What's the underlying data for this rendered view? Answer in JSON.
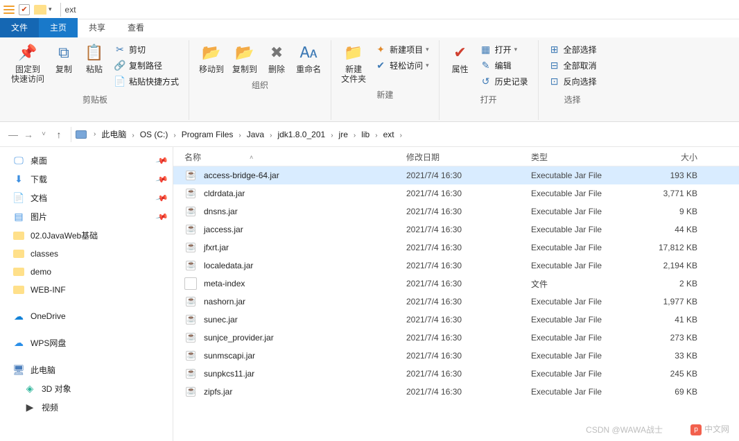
{
  "title": "ext",
  "tabs": {
    "file": "文件",
    "home": "主页",
    "share": "共享",
    "view": "查看"
  },
  "ribbon": {
    "clipboard": {
      "label": "剪贴板",
      "pin": "固定到\n快速访问",
      "copy": "复制",
      "paste": "粘贴",
      "cut": "剪切",
      "copy_path": "复制路径",
      "paste_shortcut": "粘贴快捷方式"
    },
    "organize": {
      "label": "组织",
      "move_to": "移动到",
      "copy_to": "复制到",
      "delete": "删除",
      "rename": "重命名"
    },
    "new": {
      "label": "新建",
      "new_folder": "新建\n文件夹",
      "new_item": "新建项目",
      "easy_access": "轻松访问"
    },
    "open": {
      "label": "打开",
      "properties": "属性",
      "open": "打开",
      "edit": "编辑",
      "history": "历史记录"
    },
    "select": {
      "label": "选择",
      "select_all": "全部选择",
      "select_none": "全部取消",
      "invert": "反向选择"
    }
  },
  "breadcrumb": [
    "此电脑",
    "OS (C:)",
    "Program Files",
    "Java",
    "jdk1.8.0_201",
    "jre",
    "lib",
    "ext"
  ],
  "sidebar": {
    "quick": [
      {
        "label": "桌面",
        "icon": "desktop",
        "pinned": true
      },
      {
        "label": "下载",
        "icon": "download",
        "pinned": true
      },
      {
        "label": "文档",
        "icon": "document",
        "pinned": true
      },
      {
        "label": "图片",
        "icon": "picture",
        "pinned": true
      },
      {
        "label": "02.0JavaWeb基础",
        "icon": "folder"
      },
      {
        "label": "classes",
        "icon": "folder"
      },
      {
        "label": "demo",
        "icon": "folder"
      },
      {
        "label": "WEB-INF",
        "icon": "folder"
      }
    ],
    "onedrive": "OneDrive",
    "wps": "WPS网盘",
    "thispc": "此电脑",
    "pc_items": [
      {
        "label": "3D 对象",
        "icon": "3d"
      },
      {
        "label": "视频",
        "icon": "video"
      }
    ]
  },
  "columns": {
    "name": "名称",
    "date": "修改日期",
    "type": "类型",
    "size": "大小"
  },
  "files": [
    {
      "name": "access-bridge-64.jar",
      "date": "2021/7/4 16:30",
      "type": "Executable Jar File",
      "size": "193 KB",
      "icon": "jar",
      "selected": true
    },
    {
      "name": "cldrdata.jar",
      "date": "2021/7/4 16:30",
      "type": "Executable Jar File",
      "size": "3,771 KB",
      "icon": "jar"
    },
    {
      "name": "dnsns.jar",
      "date": "2021/7/4 16:30",
      "type": "Executable Jar File",
      "size": "9 KB",
      "icon": "jar"
    },
    {
      "name": "jaccess.jar",
      "date": "2021/7/4 16:30",
      "type": "Executable Jar File",
      "size": "44 KB",
      "icon": "jar"
    },
    {
      "name": "jfxrt.jar",
      "date": "2021/7/4 16:30",
      "type": "Executable Jar File",
      "size": "17,812 KB",
      "icon": "jar"
    },
    {
      "name": "localedata.jar",
      "date": "2021/7/4 16:30",
      "type": "Executable Jar File",
      "size": "2,194 KB",
      "icon": "jar"
    },
    {
      "name": "meta-index",
      "date": "2021/7/4 16:30",
      "type": "文件",
      "size": "2 KB",
      "icon": "file"
    },
    {
      "name": "nashorn.jar",
      "date": "2021/7/4 16:30",
      "type": "Executable Jar File",
      "size": "1,977 KB",
      "icon": "jar"
    },
    {
      "name": "sunec.jar",
      "date": "2021/7/4 16:30",
      "type": "Executable Jar File",
      "size": "41 KB",
      "icon": "jar"
    },
    {
      "name": "sunjce_provider.jar",
      "date": "2021/7/4 16:30",
      "type": "Executable Jar File",
      "size": "273 KB",
      "icon": "jar"
    },
    {
      "name": "sunmscapi.jar",
      "date": "2021/7/4 16:30",
      "type": "Executable Jar File",
      "size": "33 KB",
      "icon": "jar"
    },
    {
      "name": "sunpkcs11.jar",
      "date": "2021/7/4 16:30",
      "type": "Executable Jar File",
      "size": "245 KB",
      "icon": "jar"
    },
    {
      "name": "zipfs.jar",
      "date": "2021/7/4 16:30",
      "type": "Executable Jar File",
      "size": "69 KB",
      "icon": "jar"
    }
  ],
  "watermark": {
    "csdn": "CSDN @WAWA战士",
    "php": "中文网"
  }
}
